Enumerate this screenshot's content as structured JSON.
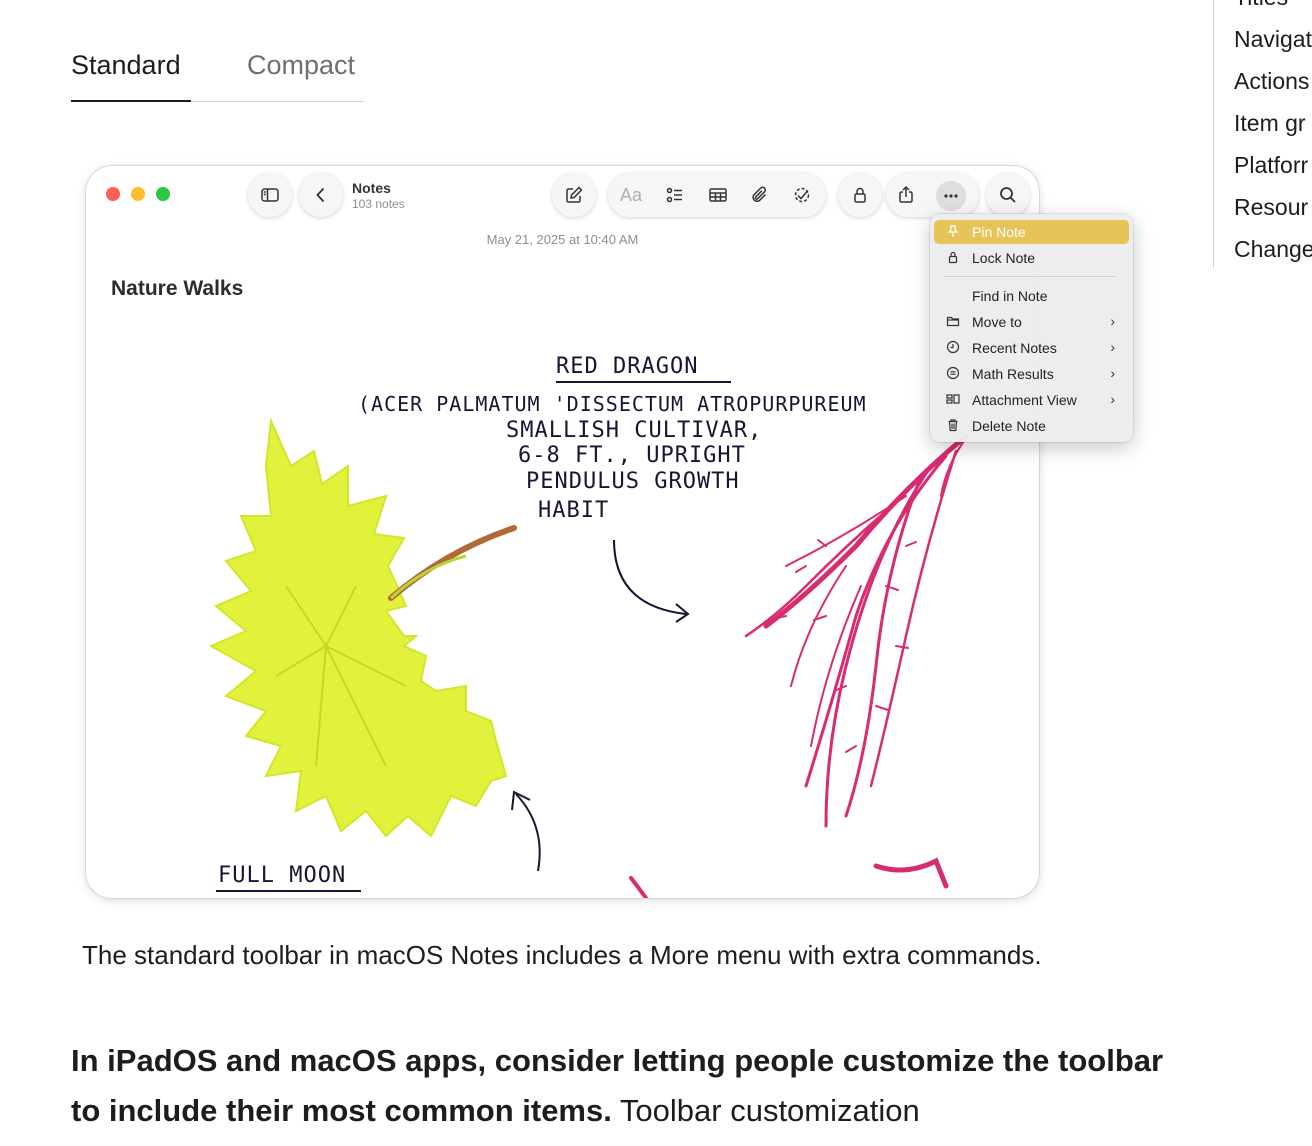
{
  "tabs": [
    {
      "label": "Standard",
      "selected": true
    },
    {
      "label": "Compact",
      "selected": false
    }
  ],
  "toc": {
    "items": [
      "Titles",
      "Navigat",
      "Actions",
      "Item gr",
      "Platforr",
      "Resour",
      "Change"
    ]
  },
  "window": {
    "traffic_lights": {
      "close": "#ff5f57",
      "minimize": "#febc2e",
      "zoom": "#28c840"
    },
    "toolbar": {
      "title": "Notes",
      "subtitle": "103 notes",
      "format_label": "Aa",
      "icons": [
        "sidebar-icon",
        "back-chevron-icon",
        "compose-icon",
        "checklist-icon",
        "table-icon",
        "paperclip-icon",
        "collaborate-icon",
        "lock-icon",
        "share-icon",
        "more-icon",
        "search-icon"
      ]
    },
    "note": {
      "date": "May 21, 2025 at 10:40 AM",
      "title": "Nature Walks",
      "handwriting": {
        "heading": "RED DRAGON",
        "line1": "(ACER PALMATUM 'DISSECTUM ATROPURPUREUM",
        "line2": "SMALLISH CULTIVAR,",
        "line3": "6-8 FT., UPRIGHT",
        "line4": "PENDULUS GROWTH",
        "line5": "HABIT",
        "label2": "FULL MOON"
      }
    },
    "menu": {
      "highlight_color": "#e6c45a",
      "items": [
        {
          "label": "Pin Note",
          "icon": "pin-icon",
          "submenu": false,
          "highlighted": true
        },
        {
          "label": "Lock Note",
          "icon": "lock-icon",
          "submenu": false,
          "highlighted": false
        },
        {
          "label": "Find in Note",
          "icon": "",
          "submenu": false,
          "highlighted": false
        },
        {
          "label": "Move to",
          "icon": "folder-icon",
          "submenu": true,
          "highlighted": false
        },
        {
          "label": "Recent Notes",
          "icon": "clock-icon",
          "submenu": true,
          "highlighted": false
        },
        {
          "label": "Math Results",
          "icon": "equals-icon",
          "submenu": true,
          "highlighted": false
        },
        {
          "label": "Attachment View",
          "icon": "attachment-view-icon",
          "submenu": true,
          "highlighted": false
        },
        {
          "label": "Delete Note",
          "icon": "trash-icon",
          "submenu": false,
          "highlighted": false
        }
      ],
      "chevron": "›"
    }
  },
  "caption": "The standard toolbar in macOS Notes includes a More menu with extra commands.",
  "body": {
    "bold": "In iPadOS and macOS apps, consider letting people customize the toolbar to include their most common items.",
    "rest": " Toolbar customization"
  }
}
